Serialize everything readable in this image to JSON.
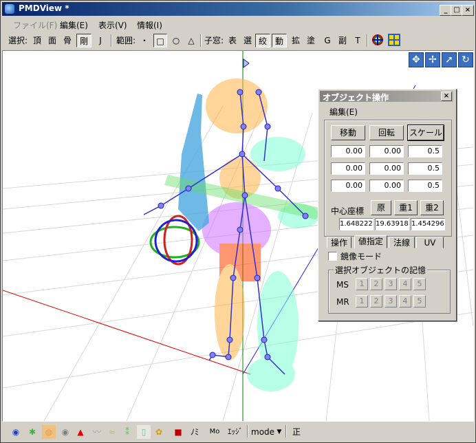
{
  "window": {
    "title": "PMDView *"
  },
  "menubar": {
    "items": [
      "ファイル(F)",
      "編集(E)",
      "表示(V)",
      "情報(I)"
    ]
  },
  "toolbar": {
    "select_label": "選択:",
    "select_items": [
      "頂",
      "面",
      "骨",
      "剛",
      "J"
    ],
    "range_label": "範囲:",
    "range_items": [
      "・",
      "□",
      "○",
      "△"
    ],
    "subwin_label": "子窓:",
    "subwin_items": [
      "表",
      "選",
      "絞",
      "動",
      "拡",
      "塗",
      "G",
      "副",
      "T"
    ]
  },
  "panel": {
    "title": "オブジェクト操作",
    "menu": "編集(E)",
    "mode_buttons": [
      "移動",
      "回転",
      "スケール"
    ],
    "rows": [
      [
        "0.00",
        "0.00",
        "0.5"
      ],
      [
        "0.00",
        "0.00",
        "0.5"
      ],
      [
        "0.00",
        "0.00",
        "0.5"
      ]
    ],
    "center_label": "中心座標",
    "center_buttons": [
      "原",
      "重1",
      "重2"
    ],
    "center_values": [
      "1.648222",
      "19.63918",
      "1.454296"
    ],
    "tabs": [
      "操作",
      "値指定",
      "法線",
      "UV"
    ],
    "mirror_label": "鏡像モード",
    "memory_group": "選択オブジェクトの記憶",
    "ms_label": "MS",
    "mr_label": "MR",
    "slots": [
      "1",
      "2",
      "3",
      "4",
      "5"
    ]
  },
  "statusbar": {
    "mode_label": "mode",
    "sei_label": "正",
    "edge_label": "ｴｯｼﾞ",
    "nomi_label": "ﾉﾐ",
    "mo_label": "Mo"
  },
  "colors": {
    "titlebar": "#0a246a",
    "accent_blue": "#3b6fc0"
  }
}
